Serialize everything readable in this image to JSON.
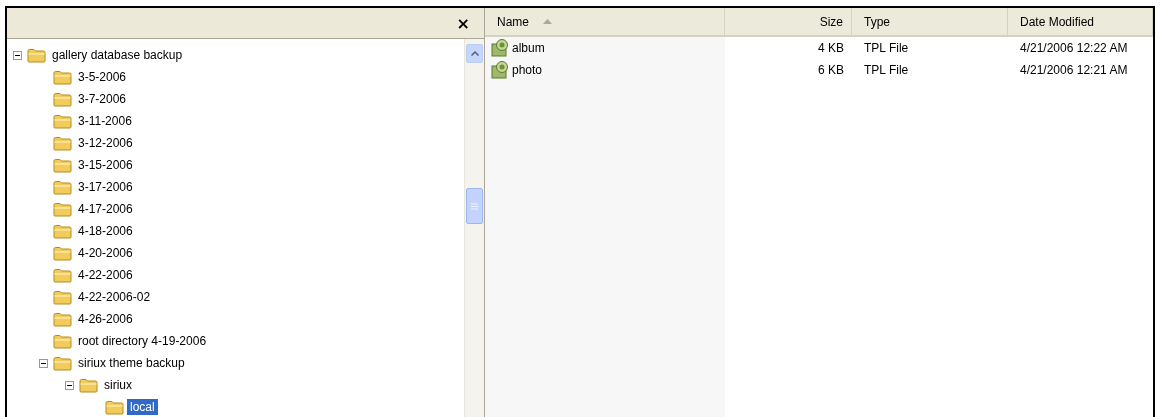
{
  "tree_pane": {
    "close_button": "×",
    "tree": [
      {
        "label": "gallery database backup",
        "expanded": true,
        "selected": false,
        "children": [
          {
            "label": "3-5-2006",
            "selected": false
          },
          {
            "label": "3-7-2006",
            "selected": false
          },
          {
            "label": "3-11-2006",
            "selected": false
          },
          {
            "label": "3-12-2006",
            "selected": false
          },
          {
            "label": "3-15-2006",
            "selected": false
          },
          {
            "label": "3-17-2006",
            "selected": false
          },
          {
            "label": "4-17-2006",
            "selected": false
          },
          {
            "label": "4-18-2006",
            "selected": false
          },
          {
            "label": "4-20-2006",
            "selected": false
          },
          {
            "label": "4-22-2006",
            "selected": false
          },
          {
            "label": "4-22-2006-02",
            "selected": false
          },
          {
            "label": "4-26-2006",
            "selected": false
          },
          {
            "label": "root directory 4-19-2006",
            "selected": false
          },
          {
            "label": "siriux theme backup",
            "expanded": true,
            "selected": false,
            "children": [
              {
                "label": "siriux",
                "expanded": true,
                "selected": false,
                "children": [
                  {
                    "label": "local",
                    "selected": true
                  }
                ]
              }
            ]
          }
        ]
      }
    ]
  },
  "file_list": {
    "columns": [
      {
        "label": "Name",
        "sorted": true
      },
      {
        "label": "Size",
        "sorted": false
      },
      {
        "label": "Type",
        "sorted": false
      },
      {
        "label": "Date Modified",
        "sorted": false
      }
    ],
    "rows": [
      {
        "name": "album",
        "size": "4 KB",
        "type": "TPL File",
        "date_modified": "4/21/2006 12:22 AM"
      },
      {
        "name": "photo",
        "size": "6 KB",
        "type": "TPL File",
        "date_modified": "4/21/2006 12:21 AM"
      }
    ]
  }
}
